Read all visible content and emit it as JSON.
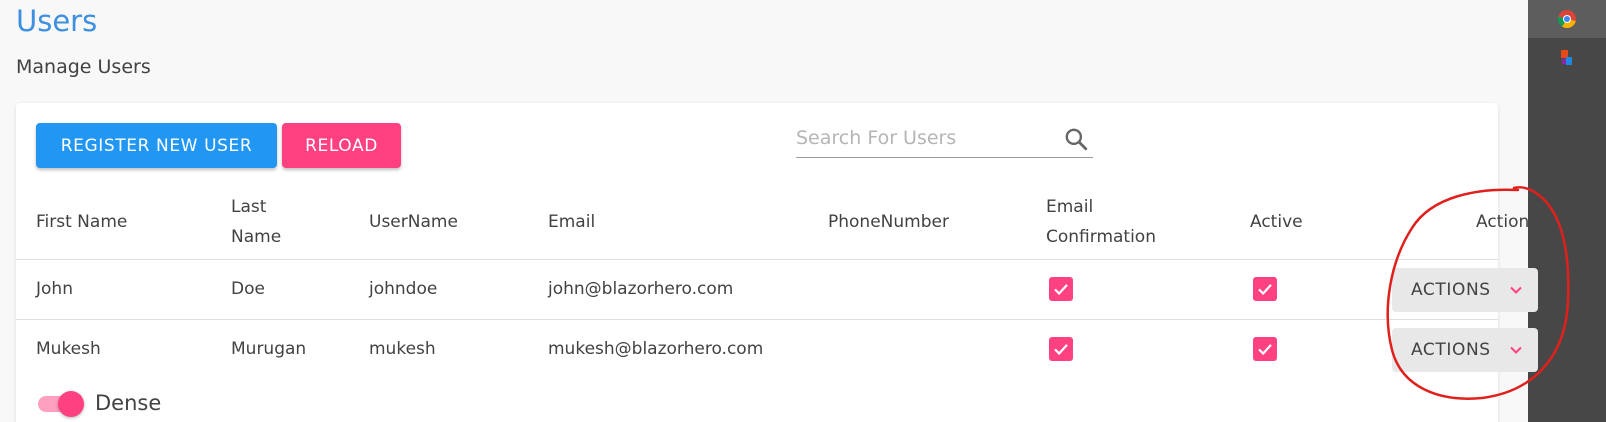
{
  "page": {
    "title": "Users",
    "subtitle": "Manage Users"
  },
  "toolbar": {
    "register_label": "REGISTER NEW USER",
    "reload_label": "RELOAD",
    "search_placeholder": "Search For Users",
    "search_value": ""
  },
  "table": {
    "headers": {
      "first_name": "First Name",
      "last_name_1": "Last",
      "last_name_2": "Name",
      "username": "UserName",
      "email": "Email",
      "phone": "PhoneNumber",
      "email_conf_1": "Email",
      "email_conf_2": "Confirmation",
      "active": "Active",
      "actions": "Actions"
    },
    "rows": [
      {
        "first_name": "John",
        "last_name": "Doe",
        "username": "johndoe",
        "email": "john@blazorhero.com",
        "phone": "",
        "email_confirmed": true,
        "active": true,
        "actions_label": "ACTIONS"
      },
      {
        "first_name": "Mukesh",
        "last_name": "Murugan",
        "username": "mukesh",
        "email": "mukesh@blazorhero.com",
        "phone": "",
        "email_confirmed": true,
        "active": true,
        "actions_label": "ACTIONS"
      }
    ]
  },
  "dense_toggle": {
    "label": "Dense",
    "on": true
  },
  "colors": {
    "primary": "#2196f3",
    "secondary": "#ff4081",
    "title": "#3d8fe0",
    "annotation": "#e0201c"
  },
  "icons": {
    "search": "search-icon",
    "checkbox": "checkbox-checked-icon",
    "chevron": "chevron-down-icon",
    "taskbar_browser": "chrome-icon",
    "taskbar_app": "app-icon"
  }
}
